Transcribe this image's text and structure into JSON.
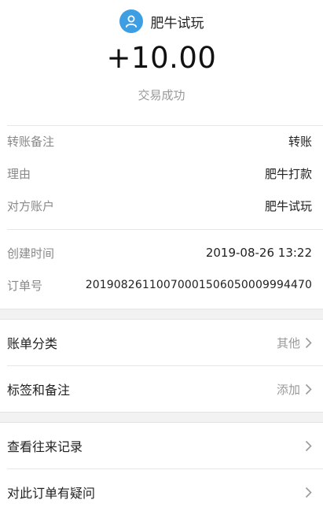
{
  "header": {
    "merchant_name": "肥牛试玩",
    "amount": "+10.00",
    "status": "交易成功",
    "avatar_icon": "user-icon",
    "avatar_color": "#3e9ee4"
  },
  "details": [
    {
      "label": "转账备注",
      "value": "转账"
    },
    {
      "label": "理由",
      "value": "肥牛打款"
    },
    {
      "label": "对方账户",
      "value": "肥牛试玩"
    },
    {
      "label": "创建时间",
      "value": "2019-08-26 13:22"
    },
    {
      "label": "订单号",
      "value": "2019082611007000150605000999447​0"
    }
  ],
  "actions": [
    {
      "label": "账单分类",
      "hint": "其他"
    },
    {
      "label": "标签和备注",
      "hint": "添加"
    },
    {
      "label": "查看往来记录",
      "hint": ""
    },
    {
      "label": "对此订单有疑问",
      "hint": ""
    }
  ]
}
